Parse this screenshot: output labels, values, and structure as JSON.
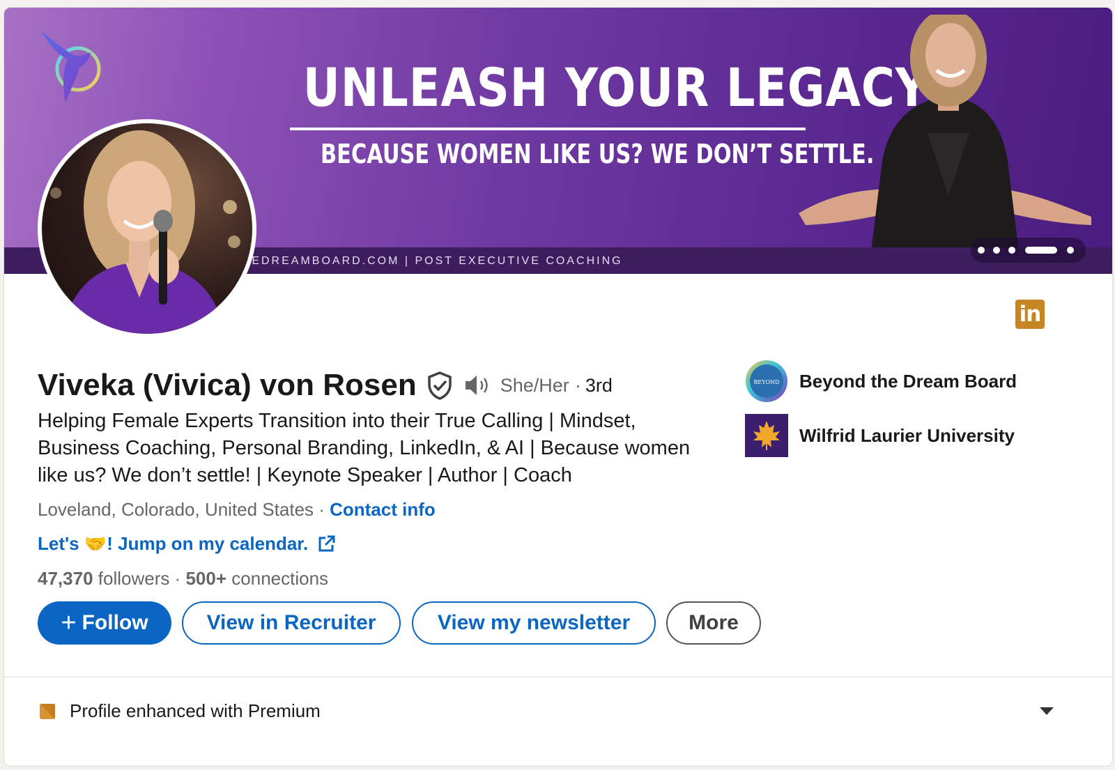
{
  "banner": {
    "headline": "UNLEASH YOUR LEGACY",
    "subline": "BECAUSE WOMEN LIKE US? WE DON’T SETTLE.",
    "footer": "BEYONDTHEDREAMBOARD.COM | POST EXECUTIVE COACHING",
    "carousel_active_index": 3,
    "carousel_count": 5
  },
  "profile": {
    "name": "Viveka (Vivica) von Rosen",
    "pronouns": "She/Her",
    "degree_sep": "·",
    "degree": "3rd",
    "headline": "Helping Female Experts Transition into their True Calling | Mindset, Business Coaching, Personal Branding, LinkedIn, & AI | Because women like us? We don’t settle! | Keynote Speaker | Author | Coach",
    "location": "Loveland, Colorado, United States",
    "location_sep": " · ",
    "contact_info": "Contact info",
    "calendar_link": "Let's 🤝! Jump on my calendar.",
    "followers_count": "47,370",
    "followers_label": " followers",
    "connections_sep": "  · ",
    "connections_count": "500+",
    "connections_label": " connections"
  },
  "actions": {
    "follow": "Follow",
    "recruiter": "View in Recruiter",
    "newsletter": "View my newsletter",
    "more": "More"
  },
  "organizations": [
    {
      "name": "Beyond the Dream Board",
      "logo_text": "BEYOND"
    },
    {
      "name": "Wilfrid Laurier University"
    }
  ],
  "premium": {
    "label": "Profile enhanced with Premium"
  },
  "colors": {
    "link_blue": "#0a66c2",
    "premium_gold": "#c78523",
    "banner_purple": "#6f3aa2"
  }
}
